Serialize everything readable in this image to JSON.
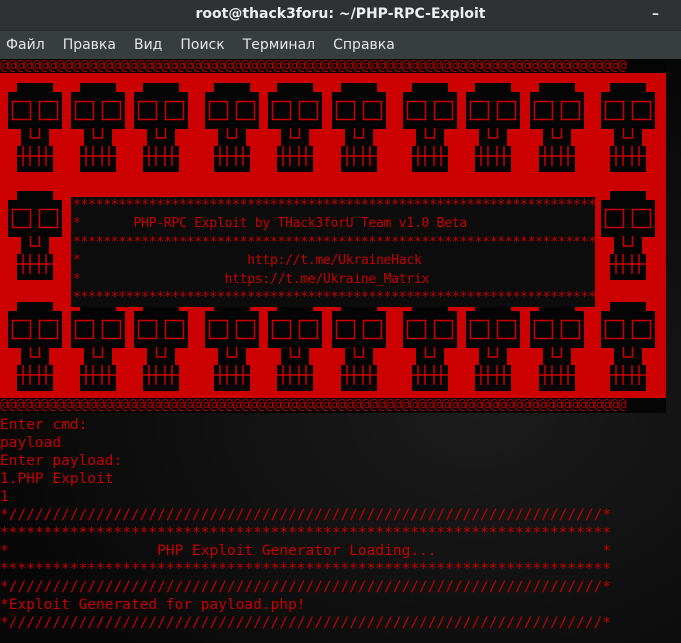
{
  "window": {
    "title": "root@thack3foru: ~/PHP-RPC-Exploit",
    "minimize_label": "–"
  },
  "menu": [
    "Файл",
    "Правка",
    "Вид",
    "Поиск",
    "Терминал",
    "Справка"
  ],
  "banner": {
    "at_row": "@@@@@@@@@@@@@@@@@@@@@@@@@@@@@@@@@@@@@@@@@@@@@@@@@@@@@@@@@@@@@@@@@@@@@@@@@@@@@@",
    "box_lines": [
      "************************************************************************",
      "*       PHP-RPC Exploit by THack3forU Team v1.0 Beta                  *",
      "************************************************************************",
      "*                      http://t.me/UkraineHack                         *",
      "*                   https://t.me/Ukraine_Matrix                        *",
      "************************************************************************"
    ]
  },
  "output_lines": [
    "Enter cmd:",
    "payload",
    "Enter payload:",
    "1.PHP Exploit",
    "1",
    "*////////////////////////////////////////////////////////////////////*",
    "**********************************************************************",
    "*                 PHP Exploit Generator Loading...                   *",
    "**********************************************************************",
    "*////////////////////////////////////////////////////////////////////*",
    "*Exploit Generated for payload.php!",
    "*////////////////////////////////////////////////////////////////////*"
  ],
  "colors": {
    "banner_red": "#cc0000",
    "text_red": "#c80000"
  }
}
